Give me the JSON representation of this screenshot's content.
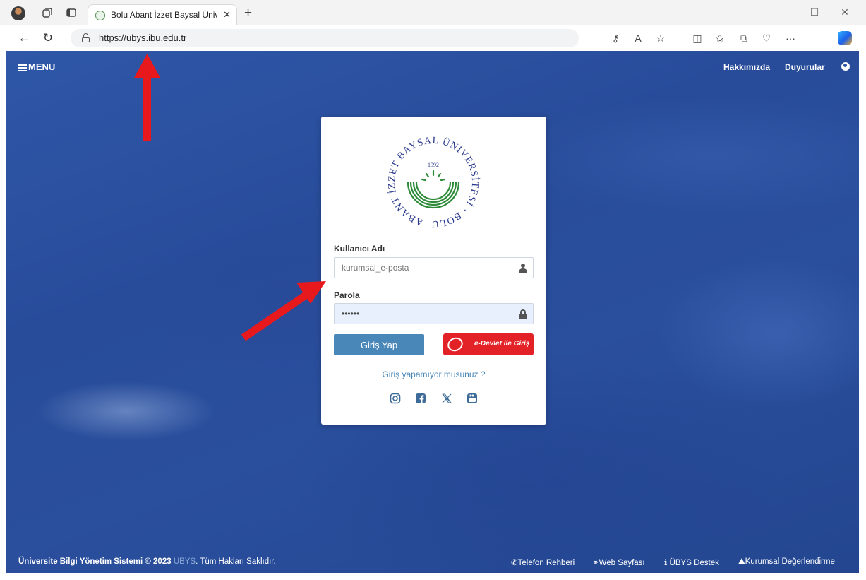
{
  "browser": {
    "tab_title": "Bolu Abant İzzet Baysal Üniversit",
    "url": "https://ubys.ibu.edu.tr",
    "more_label": "···"
  },
  "nav": {
    "menu_label": "MENU",
    "about_label": "Hakkımızda",
    "announcements_label": "Duyurular"
  },
  "logo": {
    "text": "ABANT İZZET BAYSAL ÜNİVERSİTESİ · BOLU",
    "year": "1992"
  },
  "login": {
    "username_label": "Kullanıcı Adı",
    "username_placeholder": "kurumsal_e-posta",
    "password_label": "Parola",
    "password_value": "••••••",
    "login_button": "Giriş Yap",
    "edevlet_button": "e-Devlet ile Giriş",
    "forgot_link": "Giriş yapamıyor musunuz ?"
  },
  "socials": [
    "instagram-icon",
    "facebook-icon",
    "x-icon",
    "youtube-icon"
  ],
  "footer": {
    "system_name": "Üniversite Bilgi Yönetim Sistemi © 2023",
    "ubys": "UBYS",
    "rights": ". Tüm Hakları Saklıdır.",
    "links": [
      "Telefon Rehberi",
      "Web Sayfası",
      "ÜBYS Destek",
      "Kurumsal Değerlendirme"
    ]
  },
  "colors": {
    "primary_button": "#4a87b9",
    "edevlet_red": "#e32227",
    "page_blue": "#2a4f9d",
    "annotation_red": "#e8191c"
  }
}
